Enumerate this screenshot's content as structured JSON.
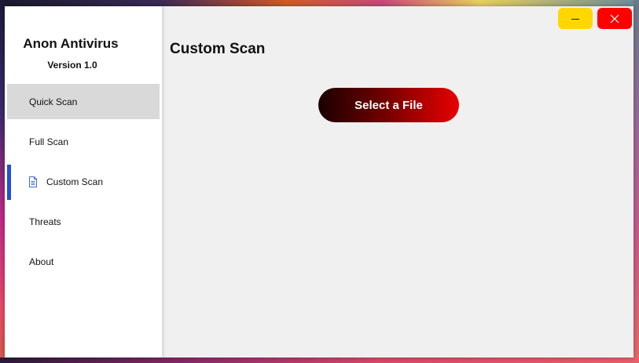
{
  "app": {
    "title": "Anon Antivirus",
    "version": "Version 1.0"
  },
  "sidebar": {
    "items": [
      {
        "label": "Quick Scan",
        "state": "hover"
      },
      {
        "label": "Full Scan",
        "state": "normal"
      },
      {
        "label": "Custom Scan",
        "state": "active",
        "icon": "document-icon"
      },
      {
        "label": "Threats",
        "state": "normal"
      },
      {
        "label": "About",
        "state": "normal"
      }
    ]
  },
  "main": {
    "title": "Custom Scan",
    "select_button_label": "Select a File"
  },
  "window_controls": {
    "minimize_icon": "minimize-icon",
    "close_icon": "close-icon"
  },
  "colors": {
    "accent": "#1f4fd9",
    "minimize": "#ffd700",
    "close": "#ff0000",
    "button_gradient_start": "#1a0000",
    "button_gradient_end": "#e80000"
  }
}
